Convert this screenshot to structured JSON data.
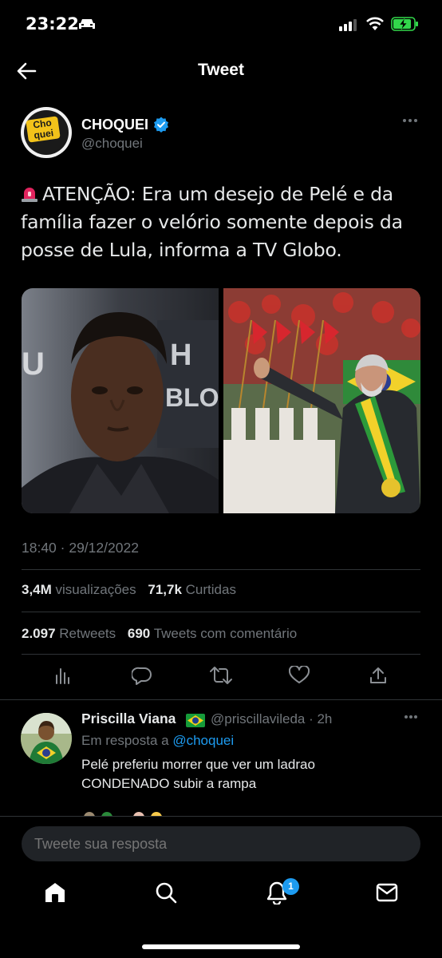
{
  "status_bar": {
    "time": "23:22"
  },
  "nav": {
    "title": "Tweet"
  },
  "tweet": {
    "author_name": "CHOQUEI",
    "author_handle": "@choquei",
    "avatar_text_line1": "Cho",
    "avatar_text_line2": "quei",
    "text": "ATENÇÃO: Era um desejo de Pelé e da família fazer o velório somente depois da posse de Lula, informa a TV Globo.",
    "timestamp": "18:40 · 29/12/2022",
    "views_count": "3,4M",
    "views_label": "visualizações",
    "likes_count": "71,7k",
    "likes_label": "Curtidas",
    "retweets_count": "2.097",
    "retweets_label": "Retweets",
    "quotes_count": "690",
    "quotes_label": "Tweets com comentário"
  },
  "reply": {
    "name": "Priscilla Viana",
    "handle_time": "@priscillavileda · 2h",
    "reply_to_prefix": "Em resposta a",
    "reply_to_mention": "@choquei",
    "text_line1": "Pelé preferiu morrer que ver um ladrao",
    "text_line2": "CONDENADO subir a rampa"
  },
  "compose": {
    "placeholder": "Tweete sua resposta"
  },
  "tabbar": {
    "notifications_badge": "1"
  },
  "colors": {
    "accent": "#1d9bf0",
    "muted": "#71767b",
    "background": "#000000"
  }
}
